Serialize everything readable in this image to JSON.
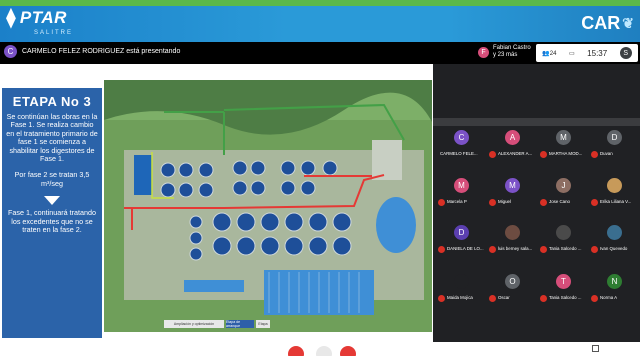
{
  "banner": {
    "left_logo": "PTAR",
    "left_logo_sub": "SALITRE",
    "right_logo": "CAR"
  },
  "meet": {
    "presenter_initial": "C",
    "presenter_text": "CARMELO FELEZ RODRIGUEZ está presentando",
    "joiner_initial": "F",
    "joiner_name": "Fabian Castro",
    "joiner_more": "y 23 más",
    "participants_count": "24",
    "chat_icon": "chat-icon",
    "time": "15:37",
    "self_initial": "S"
  },
  "slide": {
    "title": "ETAPA No 3",
    "p1": "Se continúan las obras en la Fase 1. Se realiza cambio en el tratamiento primario de fase 1 se comienza a shabilitar los digestores de Fase 1.",
    "p2": "Por fase 2 se tratan 3,5 m³/seg",
    "p3": "Fase 1, continuará tratando los excedentes que no se traten en la fase 2.",
    "map_tabs": [
      "Ampliación y optimización",
      "Etapa de arranque",
      "Etapa"
    ]
  },
  "participants": [
    {
      "initial": "C",
      "name": "CARMELO FELE...",
      "color": "#7b52c7"
    },
    {
      "initial": "A",
      "name": "ALEXANDER A...",
      "color": "#d64e7a"
    },
    {
      "initial": "M",
      "name": "MARTHA MOD...",
      "color": "#5f6368"
    },
    {
      "initial": "D",
      "name": "Duvan",
      "color": "#5f6368"
    },
    {
      "initial": "M",
      "name": "Marcela P",
      "color": "#d64e7a"
    },
    {
      "initial": "M",
      "name": "Miguel",
      "color": "#7b52c7"
    },
    {
      "initial": "J",
      "name": "Jose Cano",
      "color": "#8d6e63"
    },
    {
      "initial": "",
      "name": "Erika Liliana V...",
      "color": "#c79a5a"
    },
    {
      "initial": "D",
      "name": "DANIELA DE LO...",
      "color": "#5b3fb0"
    },
    {
      "initial": "",
      "name": "luis berney sala...",
      "color": "#6d4c41"
    },
    {
      "initial": "",
      "name": "Tania Salcedo ...",
      "color": "#4a4a4a"
    },
    {
      "initial": "",
      "name": "Ivan Quevedo",
      "color": "#3a6e8f"
    },
    {
      "initial": "",
      "name": "Maida Mojica",
      "color": "#202124"
    },
    {
      "initial": "O",
      "name": "Oscar",
      "color": "#5f6368"
    },
    {
      "initial": "T",
      "name": "Tania Salcedo ...",
      "color": "#d64e7a"
    },
    {
      "initial": "N",
      "name": "Norma A",
      "color": "#2e7d32"
    }
  ],
  "colors": {
    "banner": "#2a9ad8",
    "slide_panel": "#2b63a9",
    "mic_off": "#d93025",
    "pipe_red": "#e53935",
    "pipe_green": "#43a047",
    "tank_blue": "#1e66b8"
  }
}
